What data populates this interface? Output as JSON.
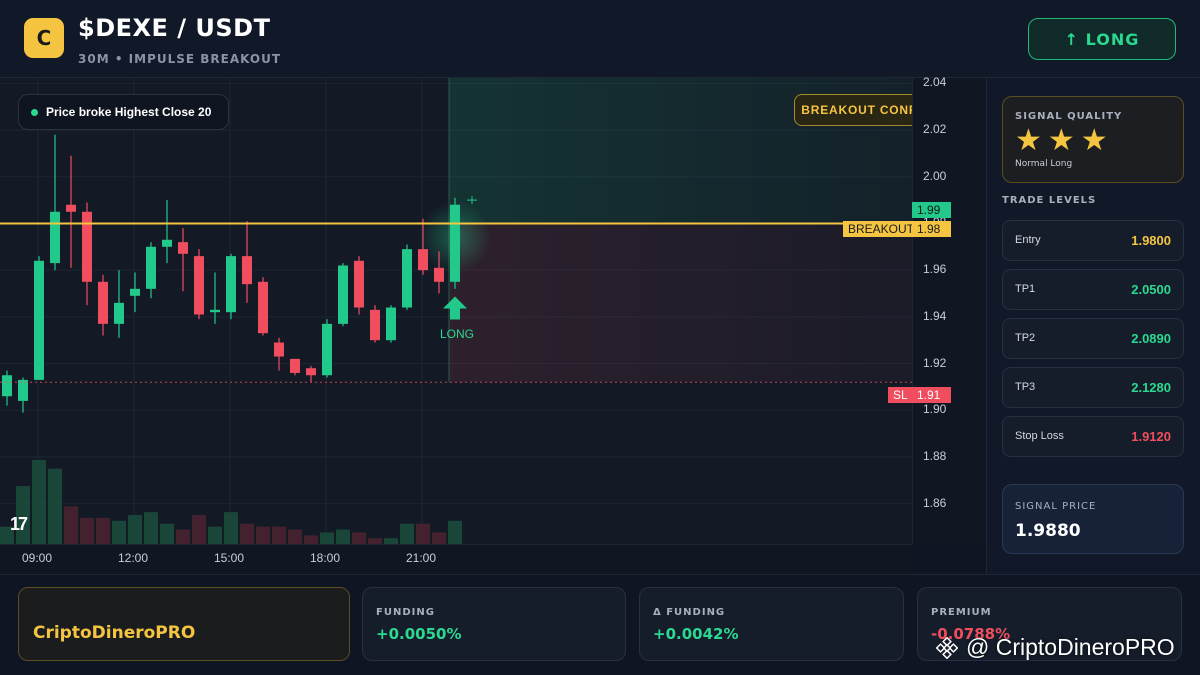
{
  "header": {
    "logo_letter": "C",
    "pair": "$DEXE / USDT",
    "subtitle": "30M • IMPULSE BREAKOUT",
    "direction_button": "↑ LONG"
  },
  "chart": {
    "info_pill": "Price broke Highest Close 20",
    "breakout_badge": "BREAKOUT CONFIRMED",
    "signal_marker_label": "LONG",
    "tv_logo": "17",
    "current_price_tag": "1.99",
    "breakout_tag_label": "BREAKOUT",
    "breakout_tag_value": "1.98",
    "sl_tag_label": "SL",
    "sl_tag_value": "1.91",
    "colors": {
      "up": "#22c98a",
      "down": "#f04e5e",
      "breakout_line": "#f5c542",
      "sl_line": "#f04e5e"
    }
  },
  "chart_data": {
    "type": "candlestick",
    "price_ticks": [
      "2.04",
      "2.02",
      "2.00",
      "1.98",
      "1.96",
      "1.94",
      "1.92",
      "1.90",
      "1.88",
      "1.86"
    ],
    "time_ticks": [
      "09:00",
      "12:00",
      "15:00",
      "18:00",
      "21:00"
    ],
    "ylim": [
      1.853,
      2.041
    ],
    "breakout_level": 1.98,
    "stop_loss_level": 1.912,
    "take_profit_zone_top": 2.04,
    "candles": [
      {
        "o": 1.906,
        "h": 1.917,
        "l": 1.902,
        "c": 1.915
      },
      {
        "o": 1.904,
        "h": 1.914,
        "l": 1.899,
        "c": 1.913
      },
      {
        "o": 1.913,
        "h": 1.966,
        "l": 1.913,
        "c": 1.964
      },
      {
        "o": 1.963,
        "h": 2.018,
        "l": 1.96,
        "c": 1.985
      },
      {
        "o": 1.988,
        "h": 2.009,
        "l": 1.961,
        "c": 1.985
      },
      {
        "o": 1.985,
        "h": 1.989,
        "l": 1.945,
        "c": 1.955
      },
      {
        "o": 1.955,
        "h": 1.958,
        "l": 1.932,
        "c": 1.937
      },
      {
        "o": 1.937,
        "h": 1.96,
        "l": 1.931,
        "c": 1.946
      },
      {
        "o": 1.949,
        "h": 1.959,
        "l": 1.942,
        "c": 1.952
      },
      {
        "o": 1.952,
        "h": 1.972,
        "l": 1.948,
        "c": 1.97
      },
      {
        "o": 1.97,
        "h": 1.99,
        "l": 1.963,
        "c": 1.973
      },
      {
        "o": 1.972,
        "h": 1.978,
        "l": 1.951,
        "c": 1.967
      },
      {
        "o": 1.966,
        "h": 1.969,
        "l": 1.939,
        "c": 1.941
      },
      {
        "o": 1.942,
        "h": 1.959,
        "l": 1.937,
        "c": 1.943
      },
      {
        "o": 1.942,
        "h": 1.967,
        "l": 1.939,
        "c": 1.966
      },
      {
        "o": 1.966,
        "h": 1.981,
        "l": 1.946,
        "c": 1.954
      },
      {
        "o": 1.955,
        "h": 1.957,
        "l": 1.932,
        "c": 1.933
      },
      {
        "o": 1.929,
        "h": 1.931,
        "l": 1.917,
        "c": 1.923
      },
      {
        "o": 1.922,
        "h": 1.922,
        "l": 1.915,
        "c": 1.916
      },
      {
        "o": 1.918,
        "h": 1.919,
        "l": 1.912,
        "c": 1.915
      },
      {
        "o": 1.915,
        "h": 1.939,
        "l": 1.914,
        "c": 1.937
      },
      {
        "o": 1.937,
        "h": 1.963,
        "l": 1.936,
        "c": 1.962
      },
      {
        "o": 1.964,
        "h": 1.966,
        "l": 1.941,
        "c": 1.944
      },
      {
        "o": 1.943,
        "h": 1.945,
        "l": 1.929,
        "c": 1.93
      },
      {
        "o": 1.93,
        "h": 1.945,
        "l": 1.929,
        "c": 1.944
      },
      {
        "o": 1.944,
        "h": 1.971,
        "l": 1.943,
        "c": 1.969
      },
      {
        "o": 1.969,
        "h": 1.982,
        "l": 1.958,
        "c": 1.96
      },
      {
        "o": 1.961,
        "h": 1.968,
        "l": 1.95,
        "c": 1.955
      },
      {
        "o": 1.955,
        "h": 1.991,
        "l": 1.952,
        "c": 1.988
      }
    ],
    "volume": [
      6,
      20,
      29,
      26,
      13,
      9,
      9,
      8,
      10,
      11,
      7,
      5,
      10,
      6,
      11,
      7,
      6,
      6,
      5,
      3,
      4,
      5,
      4,
      2,
      2,
      7,
      7,
      4,
      8
    ]
  },
  "signal_quality": {
    "title": "SIGNAL QUALITY",
    "stars": "★★★",
    "note": "Normal Long"
  },
  "trade_levels": {
    "title": "TRADE LEVELS",
    "items": [
      {
        "label": "Entry",
        "value": "1.9800",
        "color": "#f5c542"
      },
      {
        "label": "TP1",
        "value": "2.0500",
        "color": "#2bd88f"
      },
      {
        "label": "TP2",
        "value": "2.0890",
        "color": "#2bd88f"
      },
      {
        "label": "TP3",
        "value": "2.1280",
        "color": "#2bd88f"
      },
      {
        "label": "Stop Loss",
        "value": "1.9120",
        "color": "#f04e5e"
      }
    ]
  },
  "signal_price": {
    "title": "SIGNAL PRICE",
    "value": "1.9880"
  },
  "footer": {
    "brand": "CriptoDineroPRO",
    "funding_label": "FUNDING",
    "funding_value": "+0.0050%",
    "delta_funding_label": "Δ FUNDING",
    "delta_funding_value": "+0.0042%",
    "premium_label": "PREMIUM",
    "premium_value": "-0.0788%",
    "watermark": "@ CriptoDineroPRO"
  }
}
